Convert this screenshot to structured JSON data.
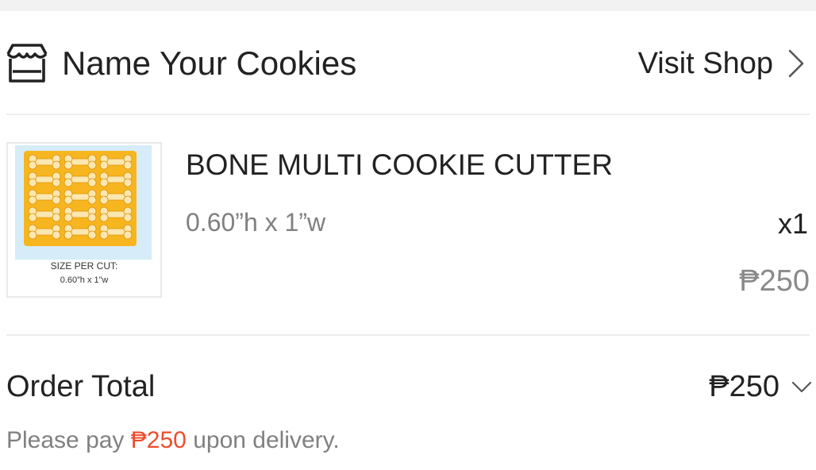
{
  "shop": {
    "name": "Name Your Cookies",
    "visit_label": "Visit Shop",
    "icon": "store-icon"
  },
  "product": {
    "title": "BONE MULTI COOKIE CUTTER",
    "variant": "0.60”h x 1”w",
    "quantity": "x1",
    "price": "₱250",
    "thumbnail": {
      "caption_line1": "SIZE PER CUT:",
      "caption_line2": "0.60”h x 1”w",
      "tray_color": "#f7b520",
      "background_color": "#d6ecf8"
    }
  },
  "order": {
    "total_label": "Order Total",
    "total_value": "₱250",
    "payment_prefix": "Please pay",
    "payment_amount": "₱250",
    "payment_suffix": "upon delivery."
  },
  "colors": {
    "accent": "#ee4d2d",
    "text_primary": "#222222",
    "text_secondary": "#808080",
    "divider": "#ececec"
  }
}
